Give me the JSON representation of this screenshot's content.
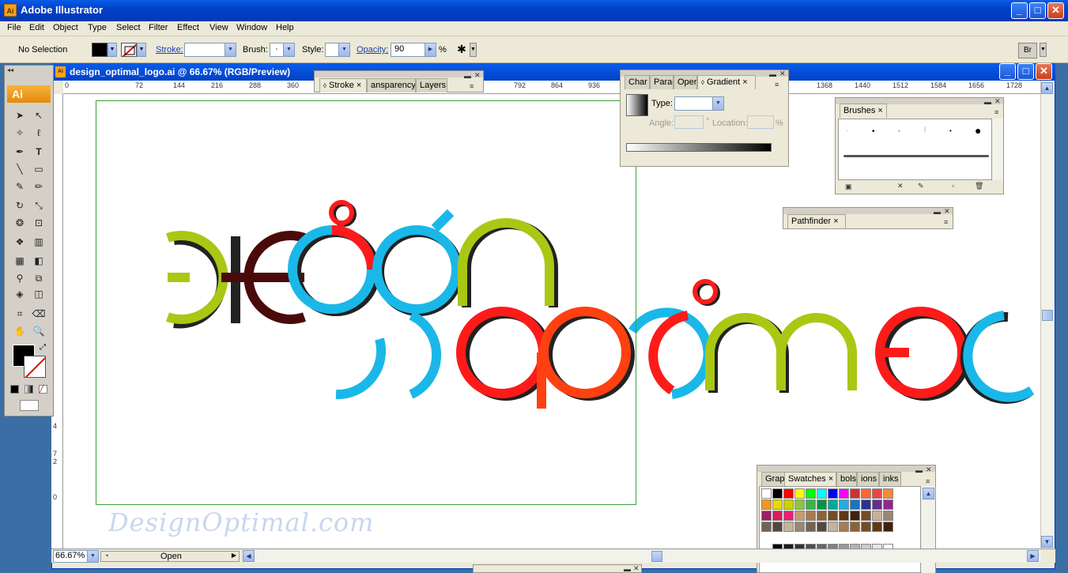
{
  "app": {
    "title": "Adobe Illustrator",
    "icon_label": "Ai"
  },
  "window_buttons": {
    "minimize": "_",
    "maximize": "□",
    "close": "✕"
  },
  "menu": [
    "File",
    "Edit",
    "Object",
    "Type",
    "Select",
    "Filter",
    "Effect",
    "View",
    "Window",
    "Help"
  ],
  "control": {
    "selection": "No Selection",
    "stroke_label": "Stroke:",
    "brush_label": "Brush:",
    "brush_value": "·",
    "style_label": "Style:",
    "opacity_label": "Opacity:",
    "opacity_value": "90",
    "percent": "%"
  },
  "document": {
    "title": "design_optimal_logo.ai @ 66.67% (RGB/Preview)",
    "zoom": "66.67%",
    "status": "Open",
    "watermark": "DesignOptimal.com"
  },
  "ruler": {
    "labels": [
      "0",
      "72",
      "144",
      "216",
      "288",
      "360",
      "792",
      "864",
      "936",
      "1368",
      "1440",
      "1512",
      "1584",
      "1656",
      "1728"
    ]
  },
  "vruler": {
    "labels": [
      "4",
      "7 2",
      "0"
    ]
  },
  "panels": {
    "stroke": {
      "tabs": [
        "Stroke",
        "ansparency",
        "Layers"
      ]
    },
    "gradient": {
      "tabs": [
        "Char",
        "Parag",
        "Oper",
        "Gradient"
      ],
      "type_label": "Type:",
      "angle_label": "Angle:",
      "location_label": "Location:",
      "degree": "°",
      "percent": "%"
    },
    "brushes": {
      "tabs": [
        "Brushes"
      ]
    },
    "pathfinder": {
      "tabs": [
        "Pathfinder"
      ]
    },
    "swatches": {
      "tabs": [
        "Grap",
        "Swatches",
        "bols",
        "ions",
        "inks"
      ]
    }
  },
  "logo_colors": {
    "green": "#a8c814",
    "maroon": "#4a0a0a",
    "red": "#ff1a1a",
    "cyan": "#1ab8e8",
    "orange": "#ff4010",
    "shadow": "#222222"
  },
  "swatch_rows": [
    [
      "#ffffff",
      "#000000",
      "#ff0000",
      "#ffff00",
      "#00ff00",
      "#00ffff",
      "#0000ff",
      "#ff00ff",
      "#cc3333",
      "#ff6633",
      "#ee4444",
      "#ff8833"
    ],
    [
      "#f7941d",
      "#e8d800",
      "#c8d400",
      "#8dc63f",
      "#39b54a",
      "#009444",
      "#00a99d",
      "#27aae1",
      "#1c75bc",
      "#2e3192",
      "#662d91",
      "#92278f"
    ],
    [
      "#9e1f63",
      "#d91c5c",
      "#ed1e79",
      "#c69c6d",
      "#a67c52",
      "#8c6239",
      "#754c24",
      "#603813",
      "#42210b",
      "#754c24",
      "#c7b299",
      "#998675"
    ],
    [
      "#736357",
      "#534741",
      "#c2b59b",
      "#998675",
      "#736357",
      "#534741",
      "#c2b59b",
      "#a67c52",
      "#8c6239",
      "#754c24",
      "#603813",
      "#42210b"
    ]
  ],
  "gray_row": [
    "#000000",
    "#1a1a1a",
    "#333333",
    "#4d4d4d",
    "#666666",
    "#808080",
    "#999999",
    "#b3b3b3",
    "#cccccc",
    "#e6e6e6",
    "#ffffff"
  ]
}
